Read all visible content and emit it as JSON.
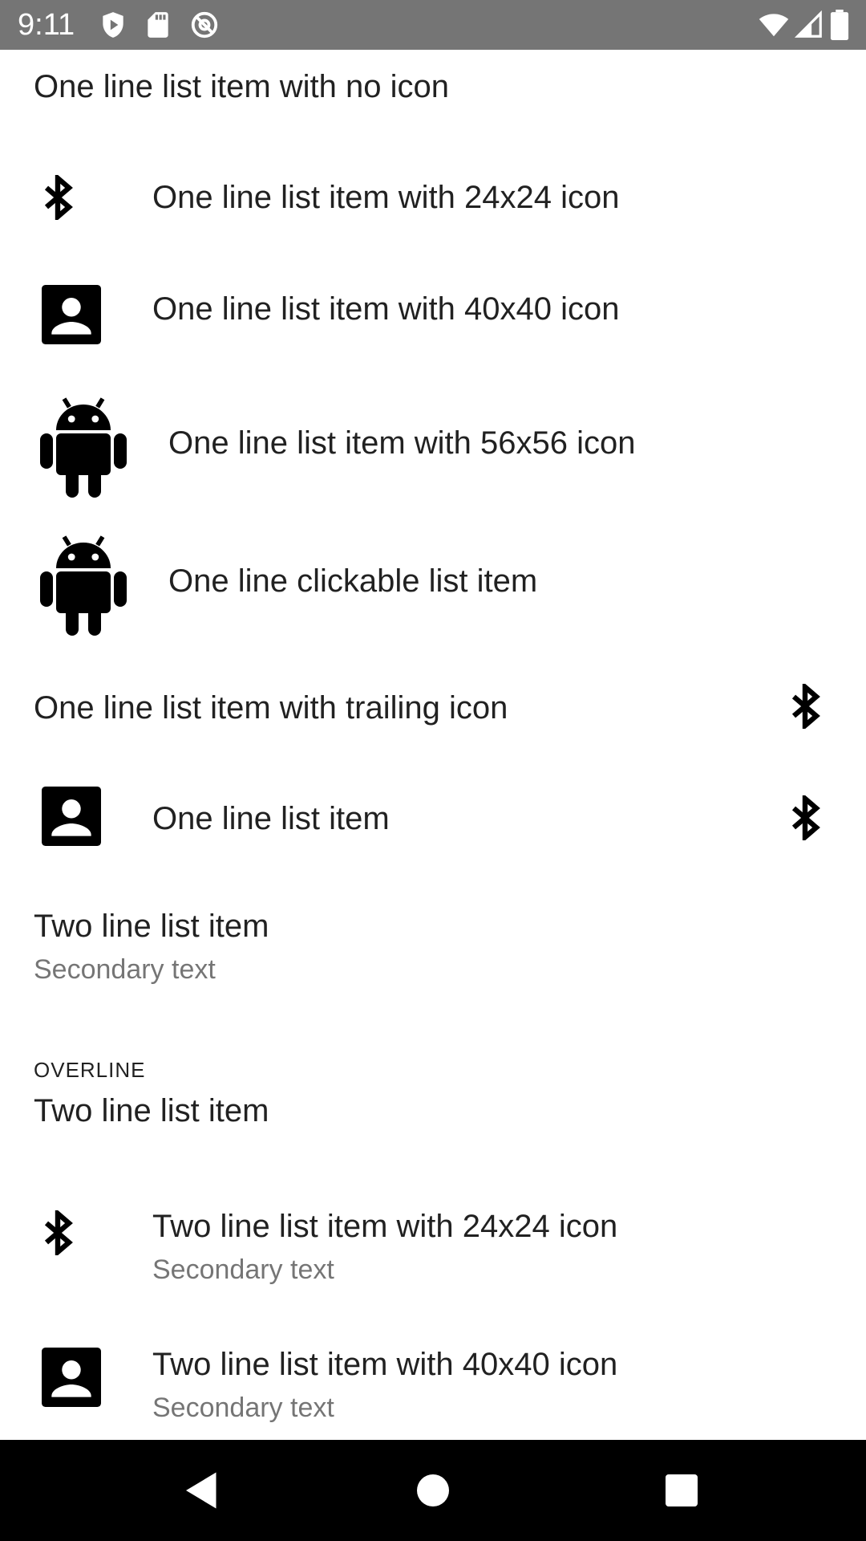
{
  "status_bar": {
    "time": "9:11",
    "background_color": "#757575",
    "left_icons": [
      "shield-icon",
      "sd-card-icon",
      "no-signal-at-icon"
    ],
    "right_icons": [
      "wifi-icon",
      "cell-signal-icon",
      "battery-icon"
    ]
  },
  "list": {
    "items": [
      {
        "primary": "One line list item with no icon"
      },
      {
        "primary": "One line list item with 24x24 icon",
        "leading_icon": "bluetooth-icon"
      },
      {
        "primary": "One line list item with 40x40 icon",
        "leading_icon": "contact-icon"
      },
      {
        "primary": "One line list item with 56x56 icon",
        "leading_icon": "android-icon"
      },
      {
        "primary": "One line clickable list item",
        "leading_icon": "android-icon"
      },
      {
        "primary": "One line list item with trailing icon",
        "trailing_icon": "bluetooth-icon"
      },
      {
        "primary": "One line list item",
        "leading_icon": "contact-icon",
        "trailing_icon": "bluetooth-icon"
      },
      {
        "primary": "Two line list item",
        "secondary": "Secondary text"
      },
      {
        "overline": "OVERLINE",
        "primary": "Two line list item"
      },
      {
        "primary": "Two line list item with 24x24 icon",
        "secondary": "Secondary text",
        "leading_icon": "bluetooth-icon"
      },
      {
        "primary": "Two line list item with 40x40 icon",
        "secondary": "Secondary text",
        "leading_icon": "contact-icon"
      }
    ]
  },
  "nav_bar": {
    "background_color": "#000000",
    "buttons": [
      "back-icon",
      "home-icon",
      "recents-icon"
    ]
  }
}
